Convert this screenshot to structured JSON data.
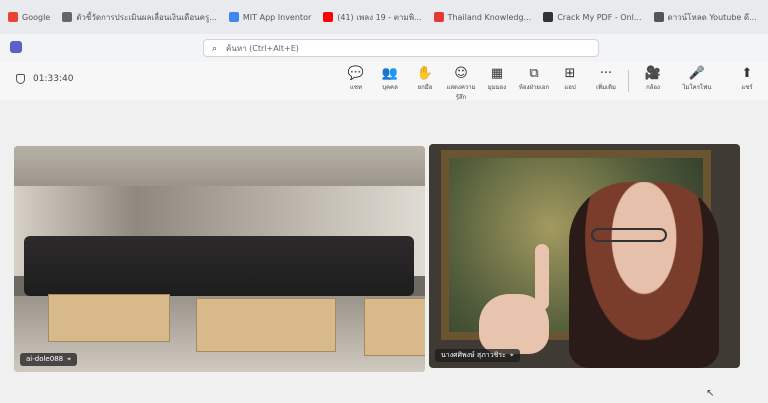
{
  "bookmarks": [
    {
      "label": "Google",
      "icon": "google-icon",
      "color": "#ea4335"
    },
    {
      "label": "ตัวชี้วัดการประเมินผลเลื่อนเงินเดือนครู...",
      "icon": "site-icon",
      "color": "#666666"
    },
    {
      "label": "MIT App Inventor",
      "icon": "google-icon",
      "color": "#4285f4"
    },
    {
      "label": "(41) เพลง 19 - ตามพิ...",
      "icon": "youtube-icon",
      "color": "#ff0000"
    },
    {
      "label": "Thailand Knowledg...",
      "icon": "site-icon",
      "color": "#e53935"
    },
    {
      "label": "Crack My PDF - Onl...",
      "icon": "site-icon",
      "color": "#333333"
    },
    {
      "label": "ดาวน์โหลด Youtube ดี...",
      "icon": "site-icon",
      "color": "#555555"
    }
  ],
  "search": {
    "placeholder": "ค้นหา (Ctrl+Alt+E)"
  },
  "meeting": {
    "timer": "01:33:40"
  },
  "toolbar": [
    {
      "label": "แชท",
      "glyph": "💬"
    },
    {
      "label": "บุคคล",
      "glyph": "👥"
    },
    {
      "label": "ยกมือ",
      "glyph": "✋"
    },
    {
      "label": "แสดงความรู้สึก",
      "glyph": "☺"
    },
    {
      "label": "มุมมอง",
      "glyph": "▦"
    },
    {
      "label": "ห้องฝ่ายเอก",
      "glyph": "⧉"
    },
    {
      "label": "แอป",
      "glyph": "⊞"
    },
    {
      "label": "เพิ่มเติม",
      "glyph": "···"
    },
    {
      "label": "กล้อง",
      "glyph": "🎥"
    },
    {
      "label": "ไมโครโฟน",
      "glyph": "🎤"
    },
    {
      "label": "แชร์",
      "glyph": "⬆"
    }
  ],
  "participants": [
    {
      "name": "ai-dole088"
    },
    {
      "name": "นางศศิพงษ์ สุภาวชิระ"
    }
  ]
}
